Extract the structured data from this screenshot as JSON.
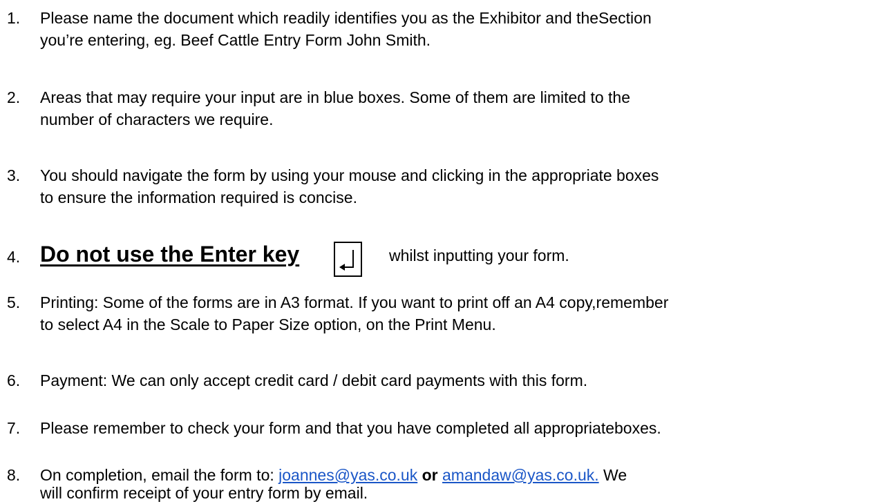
{
  "items": [
    {
      "number": "1.",
      "lines": [
        "Please name the document which readily identifies you as the Exhibitor and theSection",
        "you’re entering, eg. Beef Cattle Entry Form John Smith."
      ]
    },
    {
      "number": "2.",
      "lines": [
        "Areas that may require your input are in blue boxes. Some of them are limited to the",
        "number of characters we require."
      ]
    },
    {
      "number": "3.",
      "lines": [
        "You should navigate the form by using your mouse and clicking in the appropriate boxes",
        "to ensure the information required is concise."
      ]
    },
    {
      "number": "4.",
      "heading": "Do not use the Enter key",
      "key_icon": "enter-key-icon",
      "after": "whilst inputting your form."
    },
    {
      "number": "5.",
      "lines": [
        "Printing: Some of the forms are in A3 format. If you want to print off an A4 copy,remember",
        "to select A4 in the Scale to Paper Size option, on the Print  Menu."
      ]
    },
    {
      "number": "6.",
      "lines": [
        "Payment: We can only accept credit card / debit card payments with this  form."
      ]
    },
    {
      "number": "7.",
      "lines": [
        "Please remember to check your form and that you have completed all appropriateboxes."
      ]
    },
    {
      "number": "8.",
      "prefix": "On completion, email the form to: ",
      "email1": "joannes@yas.co.uk",
      "or_text": "or",
      "email2": "amandaw@yas.co.uk.",
      "suffix": " We",
      "line2": "will confirm receipt of your entry form by  email."
    }
  ],
  "colors": {
    "link": "#1a56c7",
    "text": "#000000"
  }
}
